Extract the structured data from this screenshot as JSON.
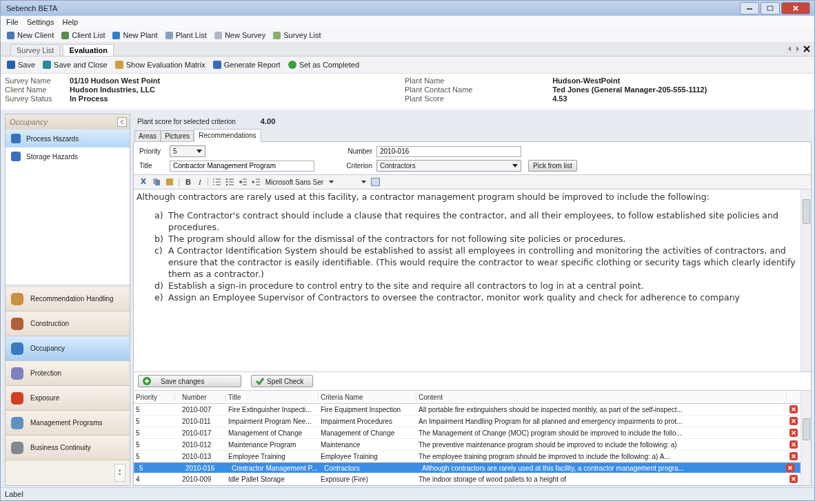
{
  "window": {
    "title": "Sebench BETA"
  },
  "menu": [
    "File",
    "Settings",
    "Help"
  ],
  "toolbar": [
    "New Client",
    "Client List",
    "New Plant",
    "Plant List",
    "New Survey",
    "Survey List"
  ],
  "doc_tabs": [
    {
      "label": "Survey List",
      "selected": false
    },
    {
      "label": "Evaluation",
      "selected": true
    }
  ],
  "doc_toolbar": [
    "Save",
    "Save and Close",
    "Show Evaluation Matrix",
    "Generate Report",
    "Set as Completed"
  ],
  "info": {
    "left": [
      {
        "label": "Survey Name",
        "value": "01/10 Hudson West Point"
      },
      {
        "label": "Client Name",
        "value": "Hudson Industries, LLC"
      },
      {
        "label": "Survey Status",
        "value": "In Process"
      }
    ],
    "right": [
      {
        "label": "Plant Name",
        "value": "Hudson-WestPoint"
      },
      {
        "label": "Plant Contact Name",
        "value": "Ted Jones (General Manager-205-555-1112)"
      },
      {
        "label": "Plant Score",
        "value": "4.53"
      }
    ]
  },
  "sidebar": {
    "header": "Occupancy",
    "items": [
      {
        "label": "Process Hazards",
        "selected": true
      },
      {
        "label": "Storage Hazards",
        "selected": false
      }
    ],
    "sections": [
      {
        "label": "Recommendation Handling",
        "selected": false
      },
      {
        "label": "Construction",
        "selected": false
      },
      {
        "label": "Occupancy",
        "selected": true
      },
      {
        "label": "Protection",
        "selected": false
      },
      {
        "label": "Exposure",
        "selected": false
      },
      {
        "label": "Management Programs",
        "selected": false
      },
      {
        "label": "Business Continuity",
        "selected": false
      }
    ]
  },
  "score": {
    "label": "Plant score for selected criterion",
    "value": "4.00"
  },
  "tabs": [
    {
      "label": "Areas",
      "selected": false
    },
    {
      "label": "Pictures",
      "selected": false
    },
    {
      "label": "Recommendations",
      "selected": true
    }
  ],
  "form": {
    "priority_label": "Priority",
    "priority": "5",
    "number_label": "Number",
    "number": "2010-016",
    "title_label": "Title",
    "title": "Contractor Management Program",
    "criterion_label": "Criterion",
    "criterion": "Contractors",
    "pick_button": "Pick from list"
  },
  "editor": {
    "bold": "B",
    "italic": "I",
    "font": "Microsoft Sans Ser",
    "intro": "Although contractors are rarely used at this facility, a contractor management program should be improved to include the following:",
    "items": [
      {
        "mark": "a)",
        "text": "The Contractor's contract should include a clause that requires the contractor, and all their employees, to follow established site policies and procedures."
      },
      {
        "mark": "b)",
        "text": "The program should allow for the dismissal of the contractors for not following site policies or procedures."
      },
      {
        "mark": "c)",
        "text": "A Contractor Identification System should be established to assist all employees in controlling and monitoring the activities of contractors, and ensure that the contractor is easily identifiable.  (This would require the contractor to wear specific clothing or security tags which clearly identify them as a contractor.)"
      },
      {
        "mark": "d)",
        "text": "Establish a sign-in procedure to control entry to the site and require all contractors to log in at a central point."
      },
      {
        "mark": "e)",
        "text": "Assign an Employee Supervisor of Contractors to oversee the contractor, monitor work quality and check for adherence to company"
      }
    ]
  },
  "buttons": [
    "Save changes",
    "Spell Check"
  ],
  "table": {
    "columns": [
      "Priority",
      "Number",
      "Title",
      "Criteria Name",
      "Content"
    ],
    "rows": [
      {
        "cells": [
          "5",
          "2010-007",
          "Fire Extinguisher Inspecti...",
          "Fire Equipment Inspection",
          "All portable fire extinguishers should be inspected monthly, as part of the self-inspect..."
        ],
        "selected": false
      },
      {
        "cells": [
          "5",
          "2010-011",
          "Impairment Program Nee...",
          "Impairment Procedures",
          "An Impairment Handling Program for all planned and emergency impairments to prot..."
        ],
        "selected": false
      },
      {
        "cells": [
          "5",
          "2010-017",
          "Management of Change",
          "Management of Change",
          "The Management of Change (MOC) program should be improved to include the follo..."
        ],
        "selected": false
      },
      {
        "cells": [
          "5",
          "2010-012",
          "Maintenance Program",
          "Maintenance",
          "The preventive maintenance program should be improved to include the following: a)"
        ],
        "selected": false
      },
      {
        "cells": [
          "5",
          "2010-013",
          "Employee Training",
          "Employee Training",
          "The employee training program should be improved to include the following:  a)     A..."
        ],
        "selected": false
      },
      {
        "cells": [
          "5",
          "2010-016",
          "Contractor Management P...",
          "Contractors",
          "Although contractors are rarely used at this facility, a contractor management progra..."
        ],
        "selected": true
      },
      {
        "cells": [
          "4",
          "2010-009",
          "Idle Pallet Storage",
          "Exposure (Fire)",
          "The indoor storage of wood pallets to a height of"
        ],
        "selected": false
      }
    ]
  },
  "status_bar": "Label"
}
